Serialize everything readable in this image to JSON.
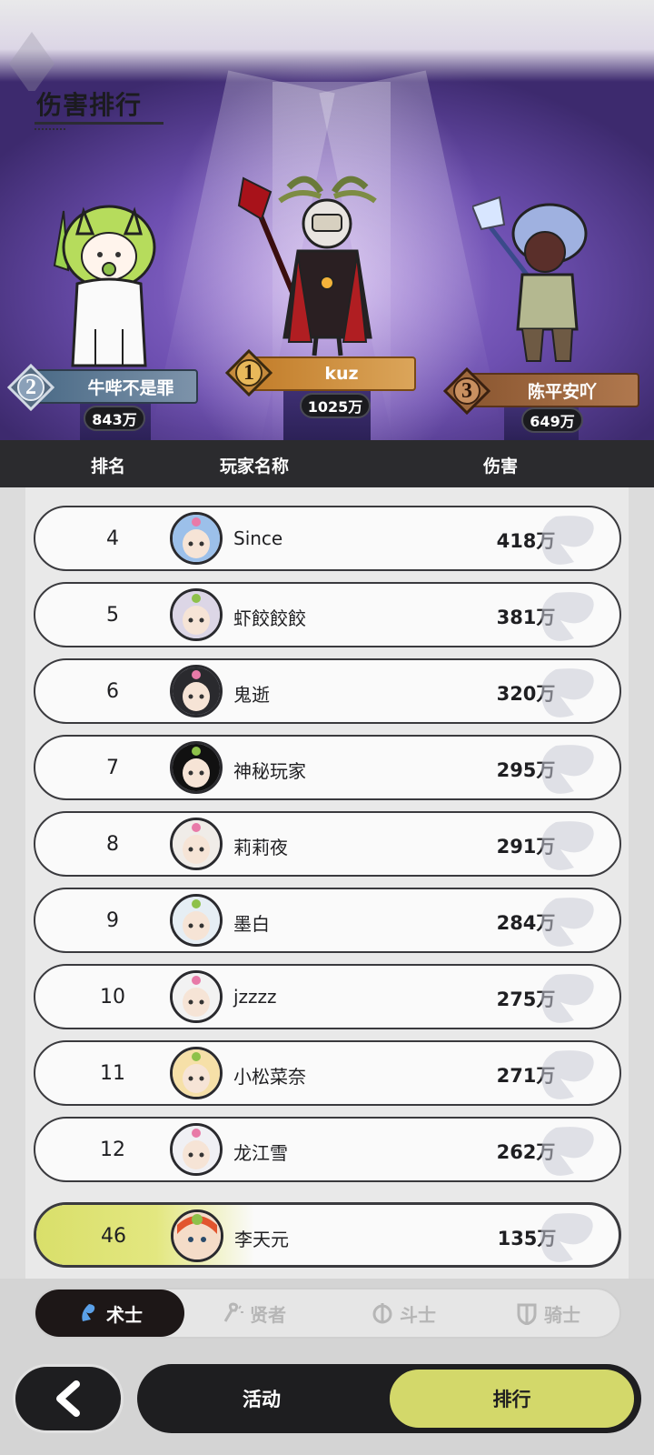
{
  "title": "伤害排行",
  "podium": [
    {
      "place": "2",
      "name": "牛哔不是罪",
      "score": "843万"
    },
    {
      "place": "1",
      "name": "kuz",
      "score": "1025万"
    },
    {
      "place": "3",
      "name": "陈平安吖",
      "score": "649万"
    }
  ],
  "table_header": {
    "rank": "排名",
    "player": "玩家名称",
    "damage": "伤害"
  },
  "rows": [
    {
      "rank": "4",
      "name": "Since",
      "damage": "418万"
    },
    {
      "rank": "5",
      "name": "虾餃餃餃",
      "damage": "381万"
    },
    {
      "rank": "6",
      "name": "鬼逝",
      "damage": "320万"
    },
    {
      "rank": "7",
      "name": "神秘玩家",
      "damage": "295万"
    },
    {
      "rank": "8",
      "name": "莉莉夜",
      "damage": "291万"
    },
    {
      "rank": "9",
      "name": "墨白",
      "damage": "284万"
    },
    {
      "rank": "10",
      "name": "jzzzz",
      "damage": "275万"
    },
    {
      "rank": "11",
      "name": "小松菜奈",
      "damage": "271万"
    },
    {
      "rank": "12",
      "name": "龙江雪",
      "damage": "262万"
    }
  ],
  "my_row": {
    "rank": "46",
    "name": "李天元",
    "damage": "135万"
  },
  "tabs": [
    {
      "label": "术士",
      "icon": "warlock-icon",
      "active": true
    },
    {
      "label": "贤者",
      "icon": "sage-icon",
      "active": false
    },
    {
      "label": "斗士",
      "icon": "fighter-icon",
      "active": false
    },
    {
      "label": "骑士",
      "icon": "knight-icon",
      "active": false
    }
  ],
  "nav": {
    "back_icon": "back-arrow-icon",
    "activity": "活动",
    "ranking": "排行"
  },
  "colors": {
    "accent": "#d3d86a",
    "dark": "#1e1e20",
    "podium_gold": "#c58a3c"
  }
}
